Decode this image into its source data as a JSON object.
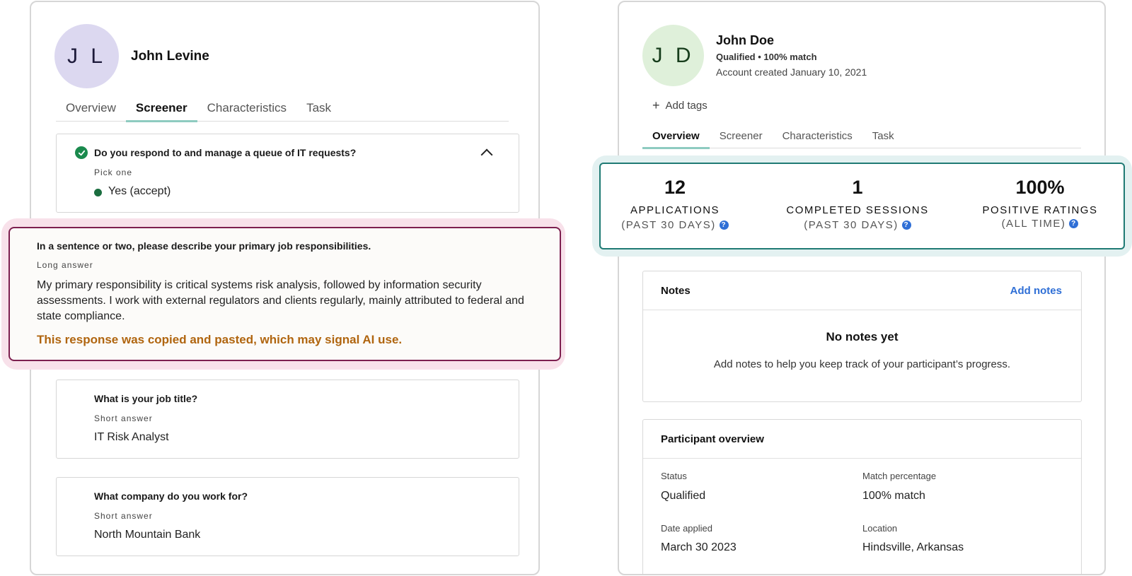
{
  "left_profile": {
    "initials": "J L",
    "name": "John Levine",
    "avatar_color": "#dcd8f0",
    "tabs": [
      {
        "label": "Overview",
        "active": false
      },
      {
        "label": "Screener",
        "active": true
      },
      {
        "label": "Characteristics",
        "active": false
      },
      {
        "label": "Task",
        "active": false
      }
    ],
    "questions": [
      {
        "question": "Do you respond to and manage a queue of IT requests?",
        "type": "Pick one",
        "answer": "Yes (accept)"
      },
      {
        "question": "In a sentence or two, please describe your primary job responsibilities.",
        "type": "Long answer",
        "answer": "My primary responsibility is critical systems risk analysis, followed by information security assessments. I work with external regulators and clients regularly, mainly attributed to federal and state compliance.",
        "warning": "This response was copied and pasted, which may signal AI use."
      },
      {
        "question": "What is your job title?",
        "type": "Short answer",
        "answer": "IT Risk Analyst"
      },
      {
        "question": "What company do you work for?",
        "type": "Short answer",
        "answer": "North Mountain Bank"
      }
    ]
  },
  "right_profile": {
    "initials": "J D",
    "name": "John Doe",
    "status_line": "Qualified • 100% match",
    "account_created": "Account created January 10, 2021",
    "add_tags_label": "Add tags",
    "avatar_color": "#dff0da",
    "tabs": [
      {
        "label": "Overview",
        "active": true
      },
      {
        "label": "Screener",
        "active": false
      },
      {
        "label": "Characteristics",
        "active": false
      },
      {
        "label": "Task",
        "active": false
      }
    ],
    "stats": [
      {
        "value": "12",
        "label": "APPLICATIONS",
        "sub": "(PAST 30 DAYS)"
      },
      {
        "value": "1",
        "label": "COMPLETED SESSIONS",
        "sub": "(PAST 30 DAYS)"
      },
      {
        "value": "100%",
        "label": "POSITIVE RATINGS",
        "sub": "(ALL TIME)"
      }
    ],
    "notes": {
      "title": "Notes",
      "add_label": "Add notes",
      "empty_title": "No notes yet",
      "empty_text": "Add notes to help you keep track of your participant’s progress."
    },
    "overview": {
      "title": "Participant overview",
      "fields": [
        {
          "label": "Status",
          "value": "Qualified"
        },
        {
          "label": "Match percentage",
          "value": "100% match"
        },
        {
          "label": "Date applied",
          "value": "March 30 2023"
        },
        {
          "label": "Location",
          "value": "Hindsville, Arkansas"
        }
      ]
    }
  },
  "colors": {
    "accent_teal": "#1f7a74",
    "warning_text": "#b0650f",
    "highlight_border": "#7d1f4f",
    "link_blue": "#2f6fd6",
    "success_green": "#1a8a4d"
  }
}
